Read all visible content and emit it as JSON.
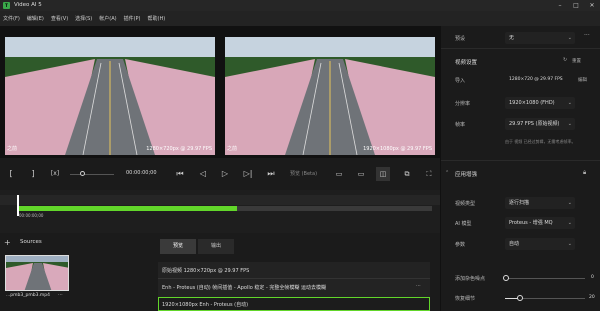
{
  "app": {
    "title": "Video AI 5"
  },
  "menu": [
    "文件(F)",
    "编辑(E)",
    "查看(V)",
    "选择(S)",
    "帐户(A)",
    "插件(P)",
    "帮助(H)"
  ],
  "preview": {
    "left_label": "之前",
    "right_label": "之前",
    "left_res": "1280×720px @ 29.97 FPS",
    "right_res": "1920×1080px @ 29.97 FPS"
  },
  "controls": {
    "timecode": "00:00:00;00",
    "mode": "预览 (Beta)"
  },
  "timeline": {
    "time": "00:00:00;00",
    "progress": 0.53
  },
  "sources": {
    "title": "Sources",
    "clip_name": "...pmb3_pmb3.mp4"
  },
  "tabs": [
    "预览",
    "输出"
  ],
  "info": {
    "line1": "原始视频    1280×720px @ 29.97 FPS",
    "line2": "Enh - Proteus (自动)   帧间插值 - Apollo   稳定 - 完整全帧模糊   运动去模糊",
    "line3": "1920×1080px   Enh - Proteus (自动)"
  },
  "side": {
    "preset_label": "预设",
    "preset_value": "无",
    "video_settings": "视频设置",
    "reset": "重置",
    "input_label": "导入",
    "input_value": "1280×720 @ 29.97 FPS",
    "edit": "编辑",
    "resolution_label": "分辨率",
    "resolution_value": "1920×1080 (FHD)",
    "fps_label": "帧率",
    "fps_value": "29.97 FPS (原始视频)",
    "fps_note": "由于 视频 已经过剪辑，无需考虑帧率。",
    "enhance_title": "应用增强",
    "model_type_label": "视频类型",
    "model_type_value": "逐行扫描",
    "ai_model_label": "AI 模型",
    "ai_model_value": "Proteus - 增强 MQ",
    "params_label": "参数",
    "params_value": "自动",
    "noise_label": "添加杂色噪点",
    "noise_value": "0",
    "grain_label": "恢复细节",
    "grain_value": "20"
  }
}
